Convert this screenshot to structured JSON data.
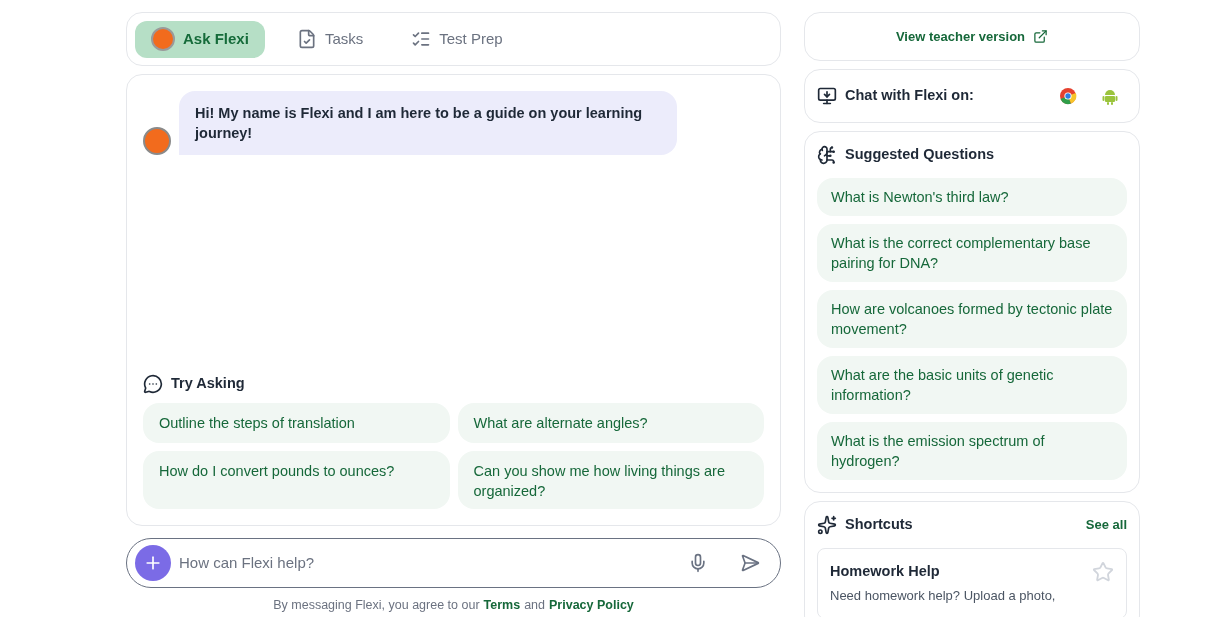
{
  "tabs": [
    {
      "label": "Ask Flexi",
      "kind": "chat",
      "selected": true
    },
    {
      "label": "Tasks",
      "kind": "tasks",
      "selected": false
    },
    {
      "label": "Test Prep",
      "kind": "test",
      "selected": false
    }
  ],
  "chat": {
    "message": "Hi! My name is Flexi and I am here to be a guide on your learning journey!"
  },
  "try_asking": {
    "title": "Try Asking",
    "items": [
      "Outline the steps of translation",
      "What are alternate angles?",
      "How do I convert pounds to ounces?",
      "Can you show me how living things are organized?"
    ]
  },
  "input": {
    "placeholder": "How can Flexi help?"
  },
  "footer": {
    "text": "By messaging Flexi, you agree to our",
    "terms": "Terms",
    "and": "and",
    "privacy": "Privacy Policy"
  },
  "teacher_link": "View teacher version",
  "chat_with": "Chat with Flexi on:",
  "suggested": {
    "title": "Suggested Questions",
    "items": [
      "What is Newton's third law?",
      "What is the correct complementary base pairing for DNA?",
      "How are volcanoes formed by tectonic plate movement?",
      "What are the basic units of genetic information?",
      "What is the emission spectrum of hydrogen?"
    ]
  },
  "shortcuts": {
    "title": "Shortcuts",
    "see_all": "See all",
    "items": [
      {
        "title": "Homework Help",
        "description": "Need homework help? Upload a photo,",
        "starred": false
      }
    ]
  }
}
